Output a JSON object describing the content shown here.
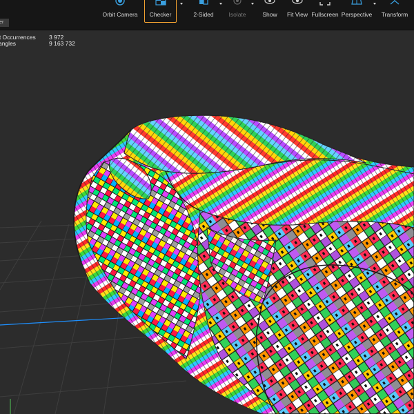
{
  "toolbar": {
    "tools": [
      {
        "label": "Orbit Camera",
        "icon": "orbit-camera-icon",
        "active": false,
        "disabled": false,
        "dropdown": false
      },
      {
        "label": "Checker",
        "icon": "checker-icon",
        "active": true,
        "disabled": false,
        "dropdown": true
      },
      {
        "label": "2-Sided",
        "icon": "two-sided-icon",
        "active": false,
        "disabled": false,
        "dropdown": true
      },
      {
        "label": "Isolate",
        "icon": "isolate-icon",
        "active": false,
        "disabled": true,
        "dropdown": false
      },
      {
        "label": "Show",
        "icon": "show-icon",
        "active": false,
        "disabled": false,
        "dropdown": false
      },
      {
        "label": "Fit View",
        "icon": "fit-view-icon",
        "active": false,
        "disabled": false,
        "dropdown": false
      },
      {
        "label": "Fullscreen",
        "icon": "fullscreen-icon",
        "active": false,
        "disabled": false,
        "dropdown": false
      },
      {
        "label": "Perspective",
        "icon": "perspective-icon",
        "active": false,
        "disabled": false,
        "dropdown": true
      },
      {
        "label": "Transform",
        "icon": "transform-icon",
        "active": false,
        "disabled": false,
        "dropdown": false
      }
    ],
    "active_color": "#f0a030"
  },
  "tab": {
    "label": "wer"
  },
  "stats": {
    "occurrences_label": "rt Occurrences",
    "occurrences_value": "3 972",
    "triangles_label": "angles",
    "triangles_value": "9 163 732"
  },
  "viewport": {
    "background": "#2c2c2c",
    "grid_color": "#3e3e3e",
    "x_axis_color": "#1e90ff",
    "y_axis_color": "#4caf50"
  }
}
